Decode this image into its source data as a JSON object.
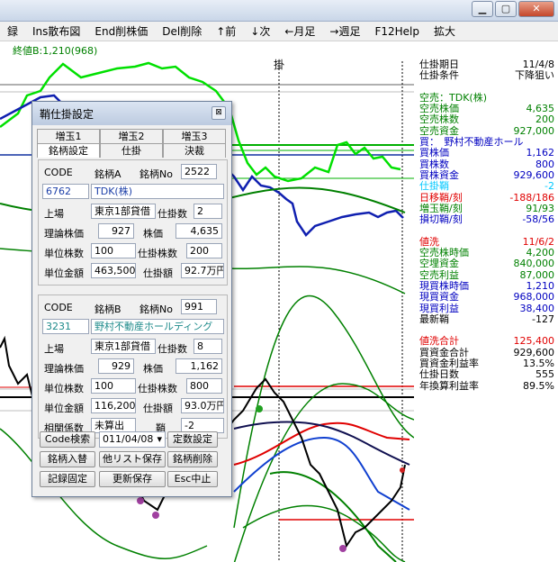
{
  "menu": [
    "録",
    "Ins散布図",
    "End削株価",
    "Del削除",
    "↑前",
    "↓次",
    "←月足",
    "→週足",
    "F12Help",
    "拡大"
  ],
  "chart_header": {
    "close_value": "終値B:1,210(968)",
    "marker": "掛"
  },
  "right_panel": [
    {
      "label": "仕掛期日",
      "value": "11/4/8",
      "color": "#000000"
    },
    {
      "label": "仕掛条件",
      "value": "下降狙い",
      "color": "#000000"
    },
    {
      "label": "",
      "value": "",
      "color": "#000000"
    },
    {
      "label": "空売：TDK(株)",
      "value": "",
      "color": "#008000"
    },
    {
      "label": "空売株価",
      "value": "4,635",
      "color": "#008000"
    },
    {
      "label": "空売株数",
      "value": "200",
      "color": "#008000"
    },
    {
      "label": "空売資金",
      "value": "927,000",
      "color": "#008000"
    },
    {
      "label": "買：　野村不動産ホール",
      "value": "",
      "color": "#0000c0"
    },
    {
      "label": "買株価",
      "value": "1,162",
      "color": "#0000c0"
    },
    {
      "label": "買株数",
      "value": "800",
      "color": "#0000c0"
    },
    {
      "label": "買株資金",
      "value": "929,600",
      "color": "#0000c0"
    },
    {
      "label": "仕掛鞘",
      "value": "-2",
      "color": "#00c8ff"
    },
    {
      "label": "日移鞘/刻",
      "value": "-188/186",
      "color": "#e00000"
    },
    {
      "label": "増玉鞘/刻",
      "value": "91/93",
      "color": "#008000"
    },
    {
      "label": "損切鞘/刻",
      "value": "-58/56",
      "color": "#0000c0"
    },
    {
      "label": "",
      "value": "",
      "color": "#000000"
    },
    {
      "label": "値洗",
      "value": "11/6/2",
      "color": "#e00000"
    },
    {
      "label": "空売株時価",
      "value": "4,200",
      "color": "#008000"
    },
    {
      "label": "空埋資金",
      "value": "840,000",
      "color": "#008000"
    },
    {
      "label": "空売利益",
      "value": "87,000",
      "color": "#008000"
    },
    {
      "label": "現買株時価",
      "value": "1,210",
      "color": "#0000c0"
    },
    {
      "label": "現買資金",
      "value": "968,000",
      "color": "#0000c0"
    },
    {
      "label": "現買利益",
      "value": "38,400",
      "color": "#0000c0"
    },
    {
      "label": "最新鞘",
      "value": "-127",
      "color": "#000000"
    },
    {
      "label": "",
      "value": "",
      "color": "#000000"
    },
    {
      "label": "値洗合計",
      "value": "125,400",
      "color": "#e00000"
    },
    {
      "label": "買資金合計",
      "value": "929,600",
      "color": "#000000"
    },
    {
      "label": "買資金利益率",
      "value": "13.5%",
      "color": "#000000"
    },
    {
      "label": "仕掛日数",
      "value": "555",
      "color": "#000000"
    },
    {
      "label": "年換算利益率",
      "value": "89.5%",
      "color": "#000000"
    }
  ],
  "dialog": {
    "title": "鞘仕掛設定",
    "close": "⊠",
    "tabs_row1": [
      "増玉1",
      "増玉2",
      "増玉3"
    ],
    "tabs_row2": [
      "銘柄設定",
      "仕掛",
      "決裁"
    ],
    "a": {
      "code_label": "CODE",
      "name_label": "銘柄A",
      "no_label": "銘柄No",
      "no": "2522",
      "code": "6762",
      "name": "TDK(株)",
      "market_label": "上場",
      "market": "東京1部貸借",
      "lots_label": "仕掛数",
      "lots": "2",
      "theo_label": "理論株価",
      "theo": "927",
      "price_label": "株価",
      "price": "4,635",
      "unit_label": "単位株数",
      "unit": "100",
      "shares_label": "仕掛株数",
      "shares": "200",
      "amt_label": "単位金額",
      "amt": "463,500",
      "total_label": "仕掛額",
      "total": "92.7万円"
    },
    "b": {
      "code_label": "CODE",
      "name_label": "銘柄B",
      "no_label": "銘柄No",
      "no": "991",
      "code": "3231",
      "name": "野村不動産ホールディング",
      "market_label": "上場",
      "market": "東京1部貸借",
      "lots_label": "仕掛数",
      "lots": "8",
      "theo_label": "理論株価",
      "theo": "929",
      "price_label": "株価",
      "price": "1,162",
      "unit_label": "単位株数",
      "unit": "100",
      "shares_label": "仕掛株数",
      "shares": "800",
      "amt_label": "単位金額",
      "amt": "116,200",
      "total_label": "仕掛額",
      "total": "93.0万円",
      "corr_label": "相関係数",
      "corr": "未算出",
      "spread_label": "鞘",
      "spread": "-2"
    },
    "buttons": {
      "code_search": "Code検索",
      "date": "011/04/08",
      "regular": "定数設定",
      "swap": "銘柄入替",
      "other_save": "他リスト保存",
      "delete": "銘柄削除",
      "fix": "記録固定",
      "update": "更新保存",
      "esc": "Esc中止"
    }
  },
  "colors": {
    "green": "#00c000",
    "blue": "#1030a0",
    "red": "#e00000",
    "dark_green": "#007000"
  }
}
